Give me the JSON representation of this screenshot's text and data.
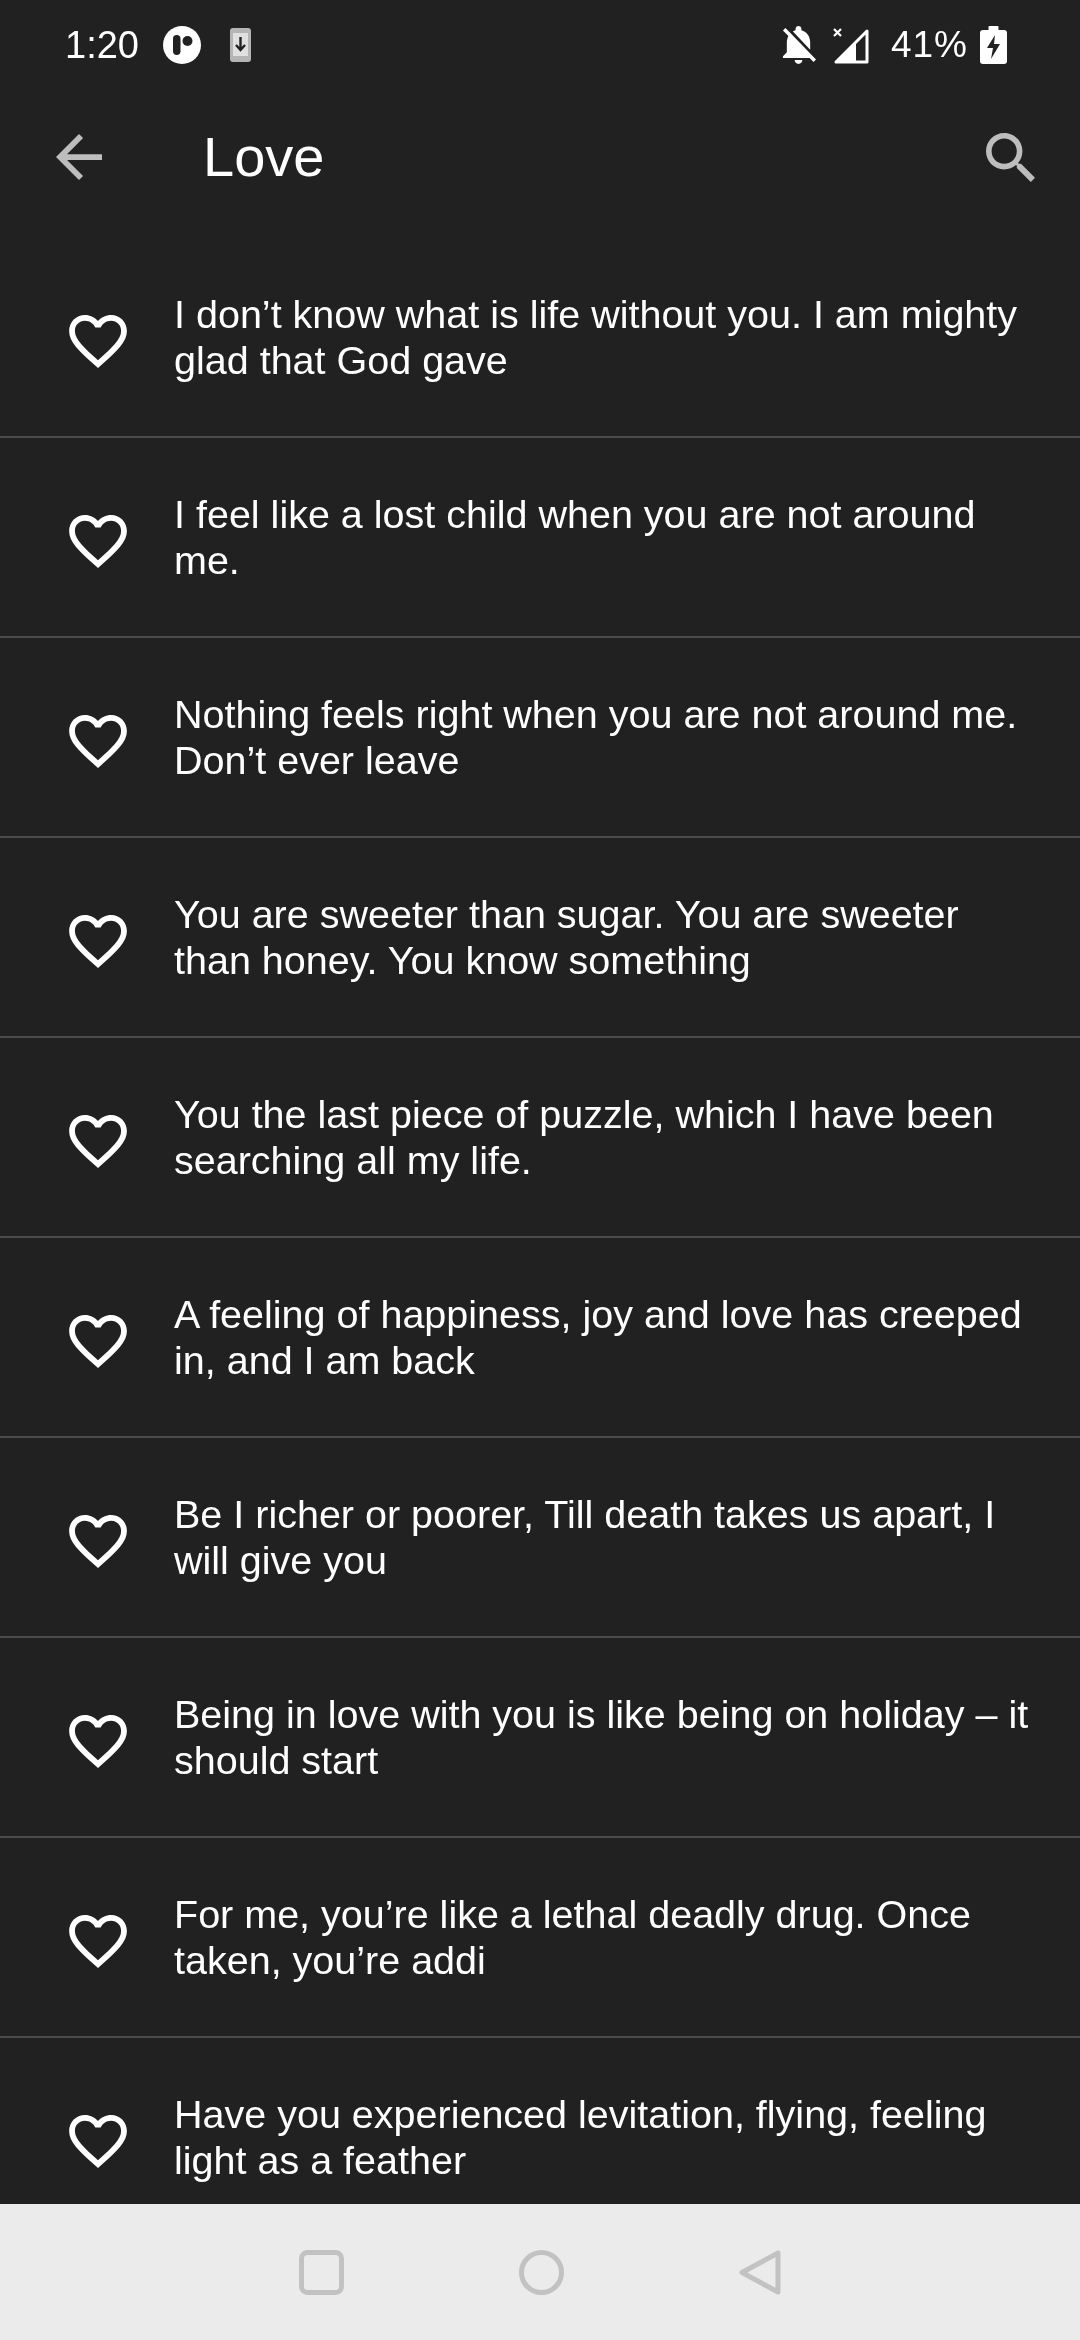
{
  "status_bar": {
    "time": "1:20",
    "battery": "41%"
  },
  "app_bar": {
    "title": "Love"
  },
  "quotes": [
    {
      "text": "I don’t know what is life without you. I am mighty glad that God gave",
      "favorite": false
    },
    {
      "text": "I feel like a lost child when you are not around me.",
      "favorite": false
    },
    {
      "text": "Nothing feels right when you are not around me. Don’t ever leave",
      "favorite": false
    },
    {
      "text": "You are sweeter than sugar. You are sweeter than honey. You know something",
      "favorite": false
    },
    {
      "text": "You the last piece of puzzle, which I have been searching all my life.",
      "favorite": false
    },
    {
      "text": "A feeling of happiness, joy and love has creeped in, and I am back",
      "favorite": false
    },
    {
      "text": "Be I richer or poorer, Till death takes us apart, I will give you",
      "favorite": false
    },
    {
      "text": "Being in love with you is like being on holiday – it should start",
      "favorite": false
    },
    {
      "text": "For me, you’re like a lethal deadly drug. Once taken, you’re addi",
      "favorite": false
    },
    {
      "text": "Have you experienced levitation, flying, feeling light as a feather",
      "favorite": false
    }
  ]
}
